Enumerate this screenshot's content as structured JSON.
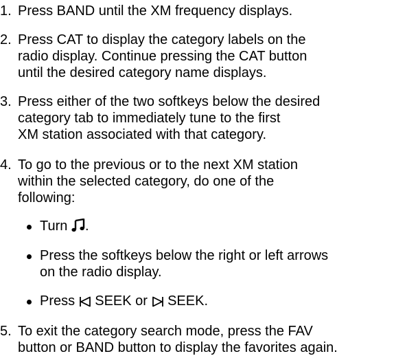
{
  "steps": [
    {
      "number": "1.",
      "lines": [
        "Press BAND until the XM frequency displays."
      ]
    },
    {
      "number": "2.",
      "lines": [
        "Press CAT to display the category labels on the",
        "radio display. Continue pressing the CAT button",
        "until the desired category name displays."
      ]
    },
    {
      "number": "3.",
      "lines": [
        "Press either of the two softkeys below the desired",
        "category tab to immediately tune to the first",
        "XM station associated with that category."
      ]
    },
    {
      "number": "4.",
      "lines": [
        "To go to the previous or to the next XM station",
        "within the selected category, do one of the",
        "following:"
      ],
      "bullets": [
        {
          "lines": [
            "Turn",
            "."
          ],
          "icon": "music-note-icon"
        },
        {
          "lines": [
            "Press the softkeys below the right or left arrows",
            "on the radio display."
          ]
        },
        {
          "lines": [
            "Press",
            "SEEK or",
            "SEEK."
          ],
          "icons": [
            "seek-back-icon",
            "seek-forward-icon"
          ]
        }
      ]
    },
    {
      "number": "5.",
      "lines": [
        "To exit the category search mode, press the FAV",
        "button or BAND button to display the favorites again."
      ]
    }
  ]
}
